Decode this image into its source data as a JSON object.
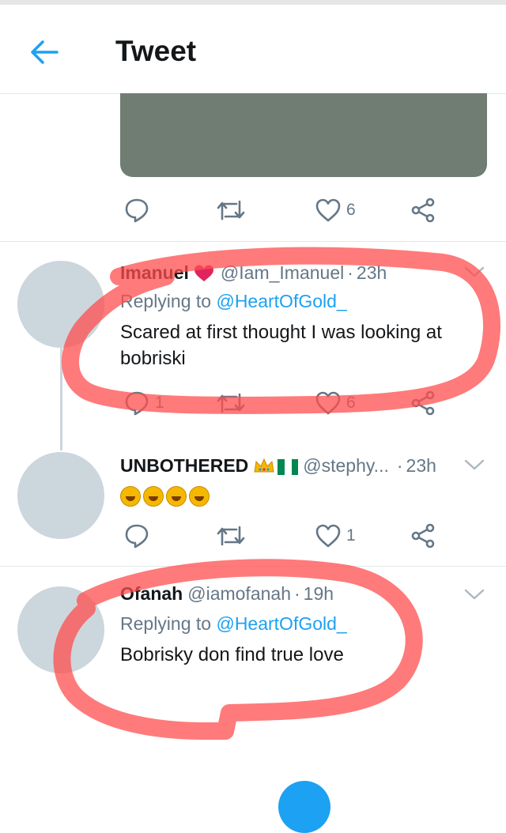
{
  "header": {
    "title": "Tweet",
    "back_icon": "back-arrow-icon"
  },
  "top_tweet": {
    "actions": {
      "reply_count": "",
      "retweet_count": "",
      "like_count": "6"
    }
  },
  "replies": [
    {
      "name": "Imanuel",
      "name_emoji": "red-heart",
      "handle": "@Iam_Imanuel",
      "time": "23h",
      "replying_prefix": "Replying to",
      "replying_handle": "@HeartOfGold_",
      "text": "Scared at first thought I was looking at bobriski",
      "actions": {
        "reply_count": "1",
        "retweet_count": "",
        "like_count": "6"
      }
    },
    {
      "name": "UNBOTHERED",
      "name_emoji": "crown, nigeria-flag",
      "handle": "@stephy...",
      "time": "23h",
      "text_emoji": "rolling-on-floor-laughing x4",
      "actions": {
        "reply_count": "",
        "retweet_count": "",
        "like_count": "1"
      }
    },
    {
      "name": "Ofanah",
      "handle": "@iamofanah",
      "time": "19h",
      "replying_prefix": "Replying to",
      "replying_handle": "@HeartOfGold_",
      "text": "Bobrisky don find true love"
    }
  ],
  "colors": {
    "accent": "#1da1f2",
    "muted": "#657786",
    "annotation": "#ff4d4d",
    "like_red": "#e0245e"
  }
}
